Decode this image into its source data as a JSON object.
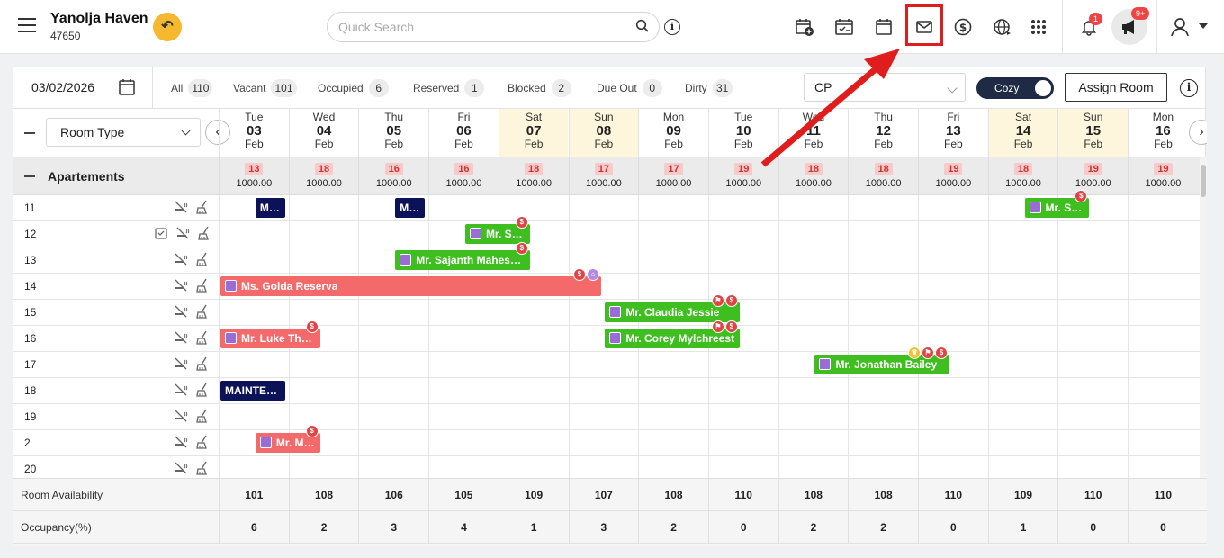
{
  "header": {
    "property_name": "Yanolja Haven",
    "property_id": "47650",
    "search_placeholder": "Quick Search",
    "notif_count": "1",
    "announce_count": "9+"
  },
  "filters": {
    "date": "03/02/2026",
    "items": [
      {
        "label": "All",
        "count": "110"
      },
      {
        "label": "Vacant",
        "count": "101"
      },
      {
        "label": "Occupied",
        "count": "6"
      },
      {
        "label": "Reserved",
        "count": "1"
      },
      {
        "label": "Blocked",
        "count": "2"
      },
      {
        "label": "Due Out",
        "count": "0"
      },
      {
        "label": "Dirty",
        "count": "31"
      }
    ],
    "rate_plan": "CP",
    "view_toggle": "Cozy",
    "assign_label": "Assign Room"
  },
  "grid": {
    "room_type_select": "Room Type",
    "days": [
      {
        "dow": "Tue",
        "day": "03",
        "mon": "Feb"
      },
      {
        "dow": "Wed",
        "day": "04",
        "mon": "Feb"
      },
      {
        "dow": "Thu",
        "day": "05",
        "mon": "Feb"
      },
      {
        "dow": "Fri",
        "day": "06",
        "mon": "Feb"
      },
      {
        "dow": "Sat",
        "day": "07",
        "mon": "Feb"
      },
      {
        "dow": "Sun",
        "day": "08",
        "mon": "Feb"
      },
      {
        "dow": "Mon",
        "day": "09",
        "mon": "Feb"
      },
      {
        "dow": "Tue",
        "day": "10",
        "mon": "Feb"
      },
      {
        "dow": "Wed",
        "day": "11",
        "mon": "Feb"
      },
      {
        "dow": "Thu",
        "day": "12",
        "mon": "Feb"
      },
      {
        "dow": "Fri",
        "day": "13",
        "mon": "Feb"
      },
      {
        "dow": "Sat",
        "day": "14",
        "mon": "Feb"
      },
      {
        "dow": "Sun",
        "day": "15",
        "mon": "Feb"
      },
      {
        "dow": "Mon",
        "day": "16",
        "mon": "Feb"
      }
    ],
    "section": {
      "name": "Apartements",
      "availability": [
        "13",
        "18",
        "16",
        "16",
        "18",
        "17",
        "17",
        "19",
        "18",
        "18",
        "19",
        "18",
        "19",
        "19"
      ],
      "rate": "1000.00"
    },
    "rooms": [
      "11",
      "12",
      "13",
      "14",
      "15",
      "16",
      "17",
      "18",
      "19",
      "2",
      "20"
    ],
    "bookings": [
      {
        "label": "MA..."
      },
      {
        "label": "MA..."
      },
      {
        "label": "Mr. Sa..."
      },
      {
        "label": "Mr. Saj..."
      },
      {
        "label": "Mr. Sajanth Maheswa..."
      },
      {
        "label": "Ms. Golda Reserva"
      },
      {
        "label": "Mr. Claudia Jessie"
      },
      {
        "label": "Mr. Luke Tho..."
      },
      {
        "label": "Mr. Corey Mylchreest"
      },
      {
        "label": "Mr. Jonathan Bailey"
      },
      {
        "label": "MAINTEN..."
      },
      {
        "label": "Mr. Ma..."
      }
    ]
  },
  "footer": {
    "availability_label": "Room Availability",
    "availability": [
      "101",
      "108",
      "106",
      "105",
      "109",
      "107",
      "108",
      "110",
      "108",
      "108",
      "110",
      "109",
      "110",
      "110"
    ],
    "occupancy_label": "Occupancy(%)",
    "occupancy": [
      "6",
      "2",
      "3",
      "4",
      "1",
      "3",
      "2",
      "0",
      "2",
      "2",
      "0",
      "1",
      "0",
      "0"
    ]
  },
  "colors": {
    "green": "#3fbe1f",
    "red": "#f46a6a",
    "navy": "#0c1257",
    "highlight": "#e01d1d"
  }
}
